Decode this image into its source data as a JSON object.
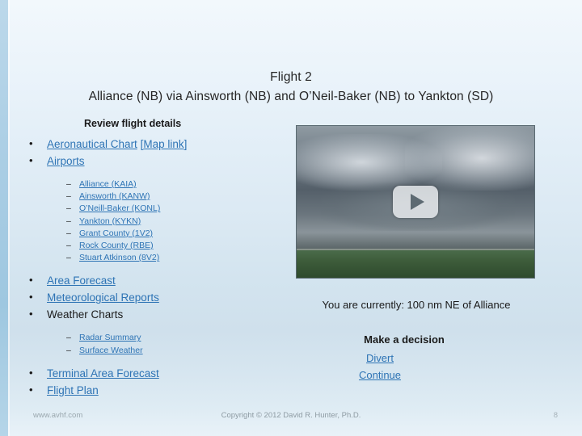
{
  "slide": {
    "title_line1": "Flight 2",
    "title_line2": "Alliance (NB) via Ainsworth (NB) and O’Neil-Baker (NB) to Yankton (SD)",
    "review_heading": "Review flight details",
    "bullets": {
      "aeronautical_chart": "Aeronautical Chart",
      "map_link_open": "[",
      "map_link": "Map link",
      "map_link_close": "]",
      "airports": "Airports",
      "airport_list": [
        "Alliance (KAIA)",
        "Ainsworth (KANW)",
        "O’Neill-Baker (KONL)",
        "Yankton (KYKN)",
        "Grant County (1V2)",
        "Rock County (RBE)",
        "Stuart Atkinson (8V2)"
      ],
      "area_forecast": "Area Forecast",
      "meteorological_reports": "Meteorological Reports",
      "weather_charts": "Weather Charts",
      "weather_chart_list": [
        "Radar Summary",
        "Surface Weather"
      ],
      "terminal_area_forecast": "Terminal Area Forecast",
      "flight_plan": "Flight Plan"
    },
    "video": {
      "play_icon": "play-icon"
    },
    "status_text": "You are currently: 100 nm NE of Alliance",
    "decision_heading": "Make a decision",
    "decision_options": [
      "Divert",
      "Continue"
    ],
    "footer": {
      "left": "www.avhf.com",
      "center": "Copyright © 2012 David R. Hunter, Ph.D.",
      "right": "8"
    },
    "colors": {
      "link": "#2e74b5",
      "text": "#1a1a1a",
      "footer": "#8e9ba3"
    }
  }
}
